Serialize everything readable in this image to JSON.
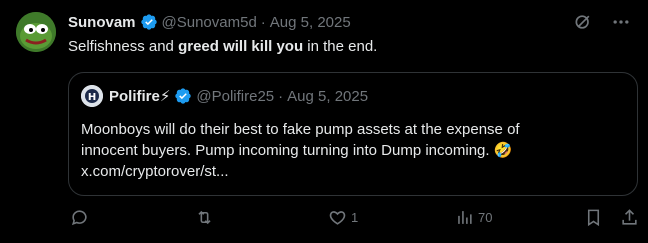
{
  "tweet": {
    "author_name": "Sunovam",
    "handle": "@Sunovam5d",
    "separator": "·",
    "date": "Aug 5, 2025",
    "text_part1": "Selfishness and ",
    "text_bold": "greed will kill you",
    "text_part2": " in the end."
  },
  "quote": {
    "author_name": "Polifire⚡",
    "handle": "@Polifire25",
    "separator": "·",
    "date": "Aug 5, 2025",
    "line1": "Moonboys will do their best to fake pump assets at the expense of",
    "line2": "innocent buyers. Pump incoming turning into Dump incoming. 🤣",
    "line3": "x.com/cryptorover/st..."
  },
  "actions": {
    "reply_count": "",
    "repost_count": "",
    "like_count": "1",
    "views_count": "70"
  },
  "icons": {
    "top": [
      "grok-icon",
      "more-icon"
    ],
    "actions": [
      "reply-icon",
      "repost-icon",
      "like-icon",
      "views-icon",
      "bookmark-icon",
      "share-icon"
    ]
  },
  "colors": {
    "background": "#000000",
    "text": "#e7e9ea",
    "muted": "#71767b",
    "verified": "#1d9bf0",
    "border": "#2f3336"
  }
}
